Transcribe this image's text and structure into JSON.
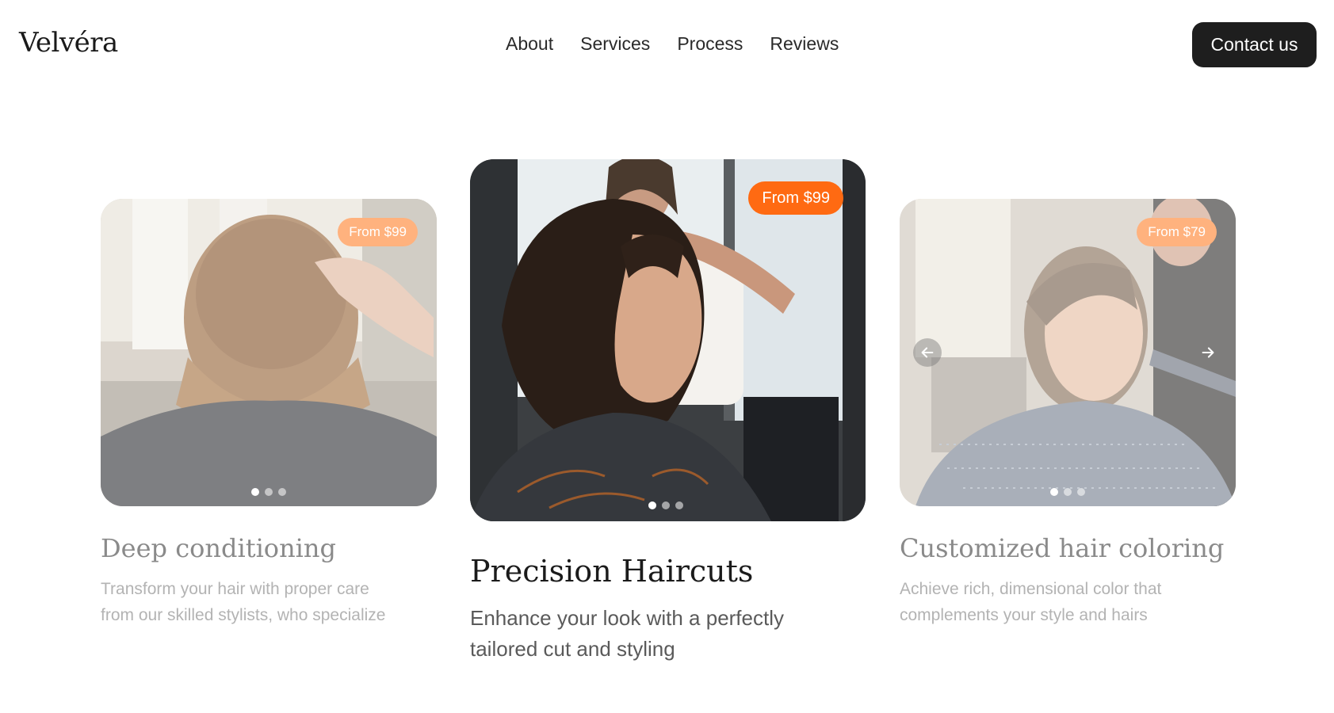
{
  "brand": {
    "logo": "Velvéra"
  },
  "nav": {
    "items": [
      "About",
      "Services",
      "Process",
      "Reviews"
    ]
  },
  "header": {
    "contact_label": "Contact us"
  },
  "cards": [
    {
      "price": "From $99",
      "title": "Deep conditioning",
      "desc_line1": "Transform your hair with proper care",
      "desc_line2": "from our skilled stylists, who specialize",
      "active_dot": 0
    },
    {
      "price": "From $99",
      "title": "Precision Haircuts",
      "desc_line1": "Enhance your look with a perfectly",
      "desc_line2": "tailored cut and styling",
      "active_dot": 0
    },
    {
      "price": "From $79",
      "title": "Customized hair coloring",
      "desc_line1": "Achieve rich, dimensional color that",
      "desc_line2": "complements your style and hairs",
      "active_dot": 0
    }
  ],
  "icons": {
    "prev": "arrow-left-icon",
    "next": "arrow-right-icon"
  },
  "colors": {
    "accent": "#ff6a12",
    "button_bg": "#1e1e1e"
  }
}
